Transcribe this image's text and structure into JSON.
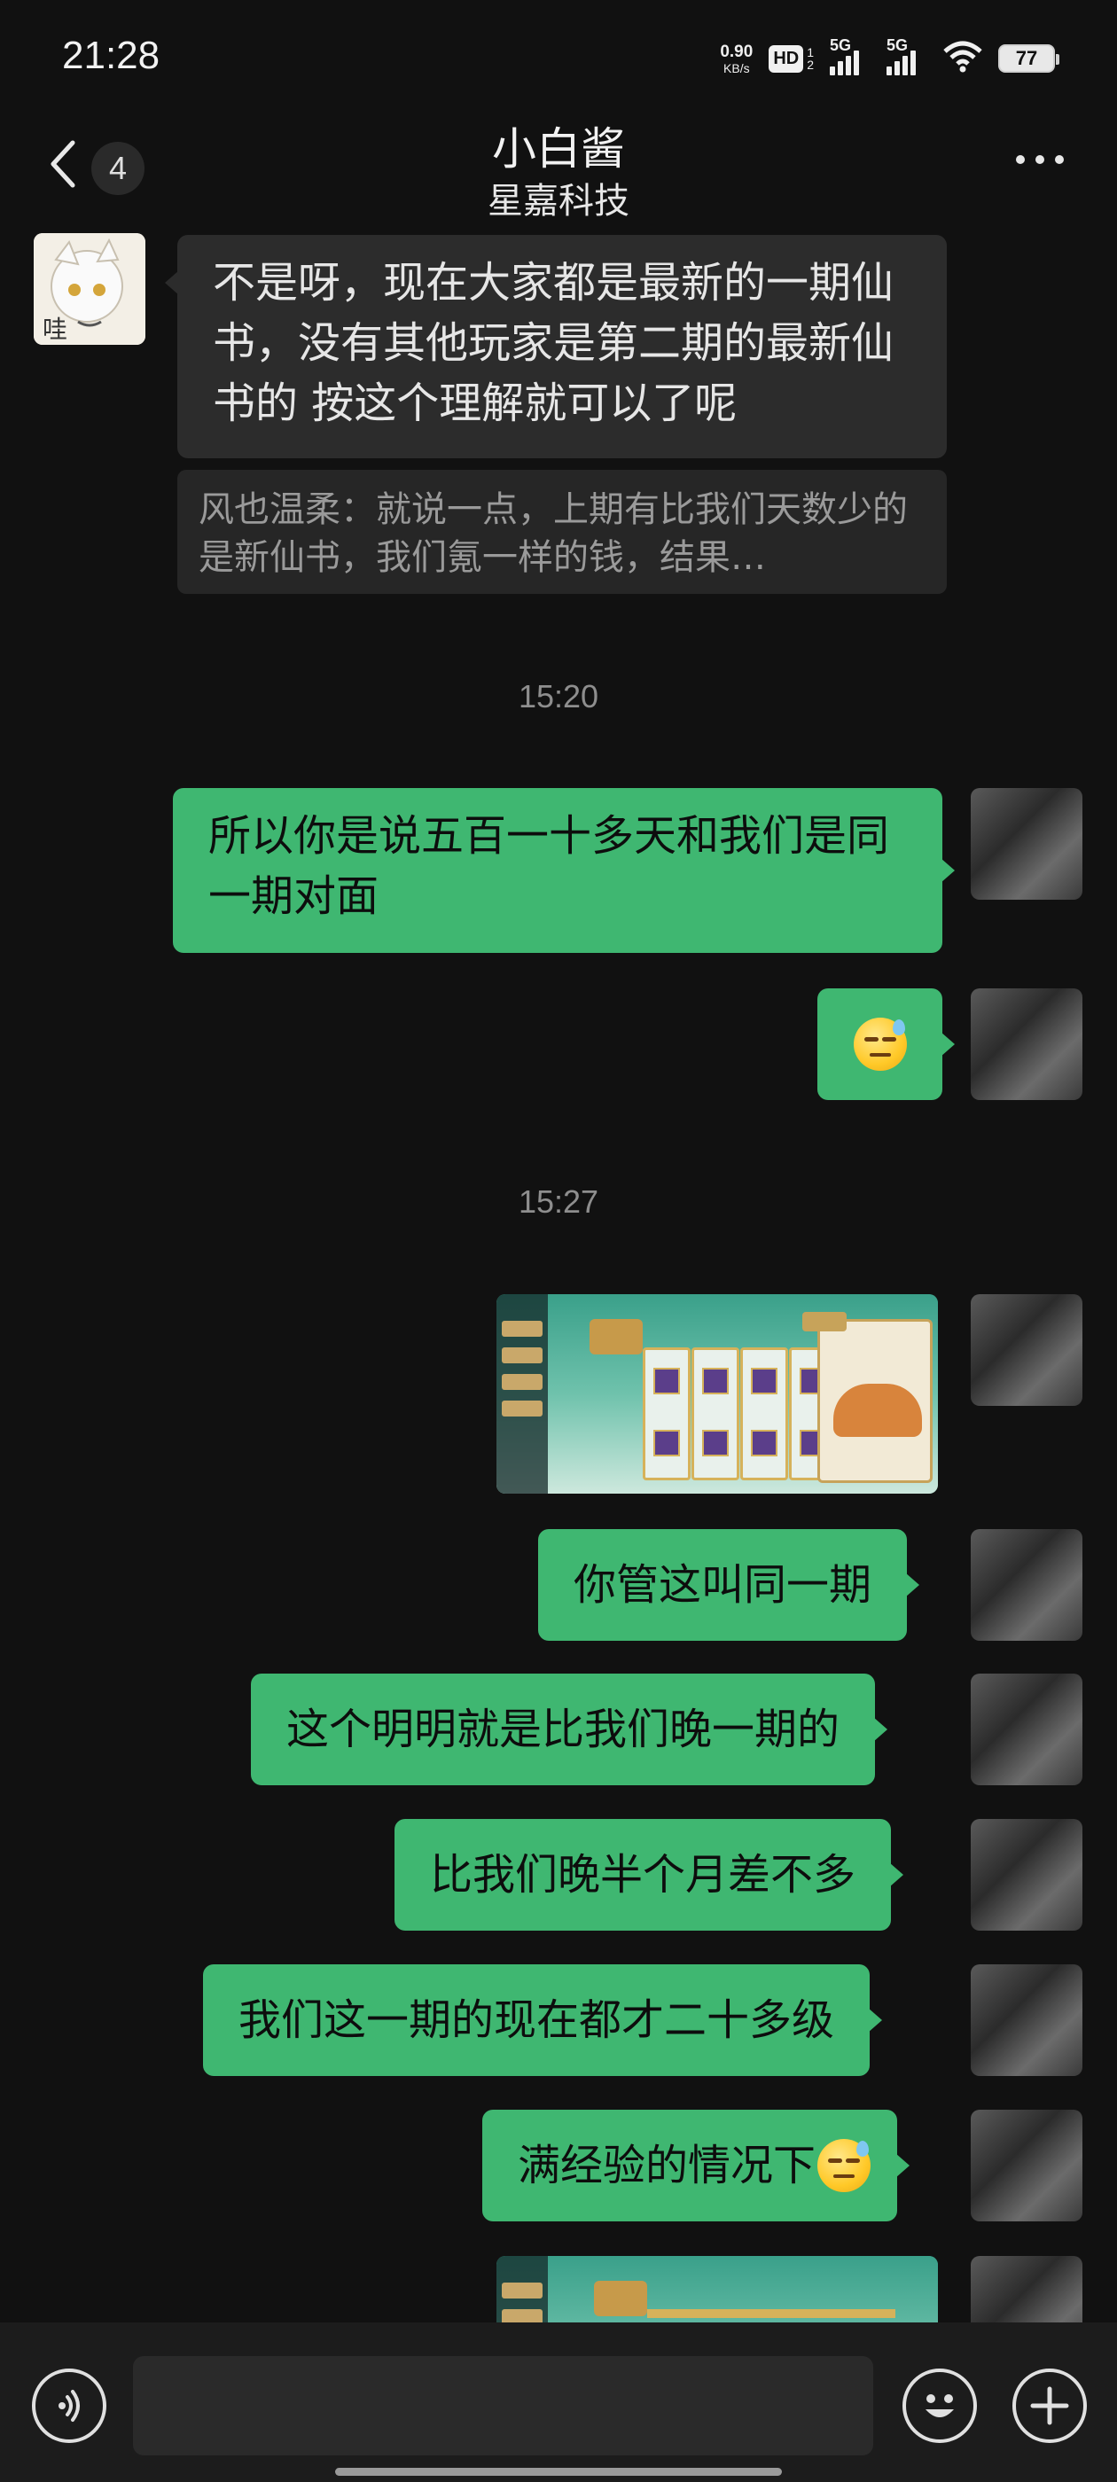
{
  "status_bar": {
    "time": "21:28",
    "net_speed_value": "0.90",
    "net_speed_unit": "KB/s",
    "hd": "HD",
    "hd_sub": "1\n2",
    "signal1": "5G",
    "signal2": "5G",
    "battery": "77"
  },
  "header": {
    "unread_count": "4",
    "title": "小白酱",
    "subtitle": "星嘉科技"
  },
  "messages": [
    {
      "side": "left",
      "type": "text",
      "text": "不是呀，现在大家都是最新的一期仙书，没有其他玩家是第二期的最新仙书的 按这个理解就可以了呢",
      "quote": "风也温柔：就说一点，上期有比我们天数少的是新仙书，我们氪一样的钱，结果…"
    },
    {
      "type": "time",
      "text": "15:20"
    },
    {
      "side": "right",
      "type": "text",
      "text": "所以你是说五百一十多天和我们是同一期对面"
    },
    {
      "side": "right",
      "type": "emoji",
      "emoji": "sweat-smile-emoji"
    },
    {
      "type": "time",
      "text": "15:27"
    },
    {
      "side": "right",
      "type": "image",
      "alt": "game-screenshot"
    },
    {
      "side": "right",
      "type": "text",
      "text": "你管这叫同一期"
    },
    {
      "side": "right",
      "type": "text",
      "text": "这个明明就是比我们晚一期的"
    },
    {
      "side": "right",
      "type": "text",
      "text": "比我们晚半个月差不多"
    },
    {
      "side": "right",
      "type": "text",
      "text": "我们这一期的现在都才二十多级"
    },
    {
      "side": "right",
      "type": "text",
      "text": "满经验的情况下",
      "emoji": "sweat-smile-emoji"
    },
    {
      "side": "right",
      "type": "image",
      "alt": "game-screenshot"
    }
  ],
  "input": {
    "value": "",
    "placeholder": ""
  },
  "colors": {
    "background": "#111111",
    "my_bubble": "#3fb771",
    "other_bubble": "#2c2c2c",
    "bottom_bar": "#1c1c1c"
  },
  "icons": {
    "back": "chevron-left-icon",
    "more": "more-dots-icon",
    "voice": "voice-icon",
    "emoji": "smile-icon",
    "plus": "plus-icon"
  }
}
